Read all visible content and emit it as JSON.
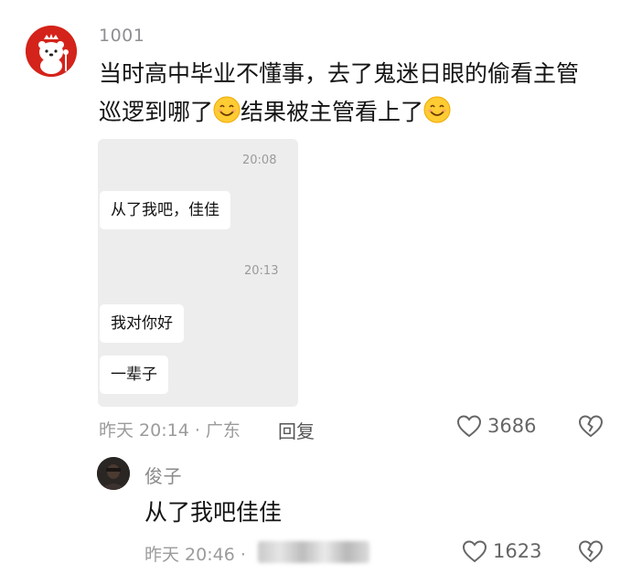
{
  "comment": {
    "username": "1001",
    "text_line1": "当时高中毕业不懂事，去了鬼迷日眼的偷看主管",
    "text_line2a": "巡逻到哪了",
    "text_line2b": "结果被主管看上了",
    "chat": {
      "time1": "20:08",
      "msg1": "从了我吧，佳佳",
      "time2": "20:13",
      "msg2": "我对你好",
      "msg3": "一辈子"
    },
    "meta": "昨天 20:14 · 广东",
    "reply_label": "回复",
    "like_count": "3686"
  },
  "reply": {
    "username": "俊子",
    "text": "从了我吧佳佳",
    "meta": "昨天 20:46 ·",
    "like_count": "1623"
  },
  "colors": {
    "avatar_red": "#d4231a",
    "chat_bg": "#ededed"
  },
  "icons": [
    "heart-outline-icon",
    "broken-heart-icon",
    "smile-emoji-icon"
  ]
}
